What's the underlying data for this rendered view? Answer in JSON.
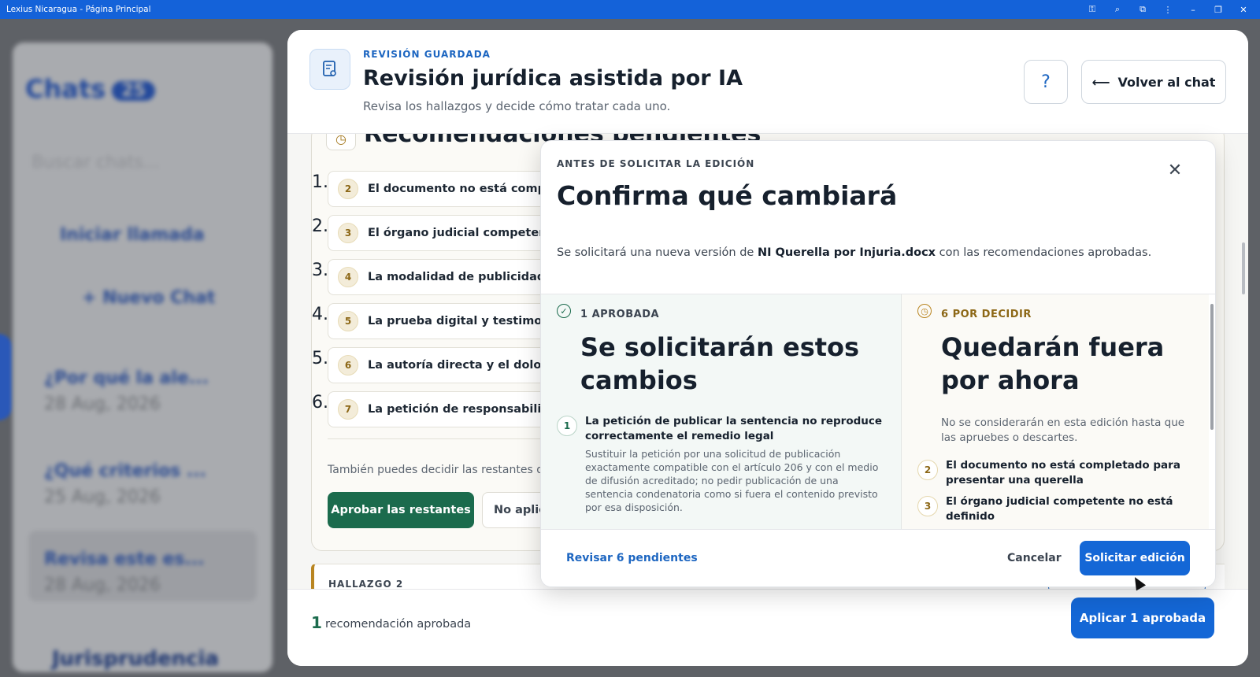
{
  "window": {
    "title": "Lexius Nicaragua - Página Principal",
    "icons": [
      "key-icon",
      "zoom-icon",
      "extension-icon",
      "more-icon",
      "minimize-icon",
      "restore-icon",
      "close-icon"
    ]
  },
  "background_sidebar": {
    "title": "Chats",
    "badge": "25",
    "search_placeholder": "Buscar chats...",
    "start_call": "Iniciar llamada",
    "new_chat": "+ Nuevo Chat",
    "items": [
      {
        "title": "¿Por qué la ale...",
        "date": "28 Aug, 2026"
      },
      {
        "title": "¿Qué criterios ...",
        "date": "25 Aug, 2026"
      },
      {
        "title": "Revisa este es...",
        "date": "28 Aug, 2026"
      }
    ],
    "footer_text": "Jurisprudencia"
  },
  "header": {
    "kicker": "REVISIÓN GUARDADA",
    "title": "Revisión jurídica asistida por IA",
    "subtitle": "Revisa los hallazgos y decide cómo tratar cada uno.",
    "help_label": "?",
    "back_label": "Volver al chat"
  },
  "pending": {
    "heading": "Recomendaciones pendientes",
    "items": [
      {
        "index": "1.",
        "badge": "2",
        "text": "El documento no está completado para presentar una querella"
      },
      {
        "index": "2.",
        "badge": "3",
        "text": "El órgano judicial competente no está definido"
      },
      {
        "index": "3.",
        "badge": "4",
        "text": "La modalidad de publicidad y difusión"
      },
      {
        "index": "4.",
        "badge": "5",
        "text": "La prueba digital y testimonial"
      },
      {
        "index": "5.",
        "badge": "6",
        "text": "La autoría directa y el dolo se"
      },
      {
        "index": "6.",
        "badge": "7",
        "text": "La petición de responsabilidad"
      }
    ],
    "also_text": "También puedes decidir las restantes de una vez.",
    "approve_rest": "Aprobar las restantes",
    "no_apply": "No aplicar",
    "finding_kicker": "HALLAZGO 2"
  },
  "footer": {
    "count": "1",
    "label": "recomendación aprobada",
    "apply_button": "Aplicar 1 aprobada"
  },
  "modal": {
    "kicker": "ANTES DE SOLICITAR LA EDICIÓN",
    "title": "Confirma qué cambiará",
    "desc_prefix": "Se solicitará una nueva versión de ",
    "desc_file": "NI Querella por Injuria.docx",
    "desc_suffix": " con las recomendaciones aprobadas.",
    "approved": {
      "kicker": "1 APROBADA",
      "title": "Se solicitarán estos cambios",
      "item_badge": "1",
      "item_title": "La petición de publicar la sentencia no reproduce correctamente el remedio legal",
      "item_desc": "Sustituir la petición por una solicitud de publicación exactamente compatible con el artículo 206 y con el medio de difusión acreditado; no pedir publicación de una sentencia condenatoria como si fuera el contenido previsto por esa disposición."
    },
    "pending": {
      "kicker": "6 POR DECIDIR",
      "title": "Quedarán fuera por ahora",
      "note": "No se considerarán en esta edición hasta que las apruebes o descartes.",
      "items": [
        {
          "badge": "2",
          "text": "El documento no está completado para presentar una querella"
        },
        {
          "badge": "3",
          "text": "El órgano judicial competente no está definido"
        }
      ]
    },
    "review_link": "Revisar 6 pendientes",
    "cancel": "Cancelar",
    "submit": "Solicitar edición"
  },
  "colors": {
    "accent_blue": "#1467d6",
    "approve_green": "#1b6b4d",
    "pending_gold": "#8c6716"
  }
}
